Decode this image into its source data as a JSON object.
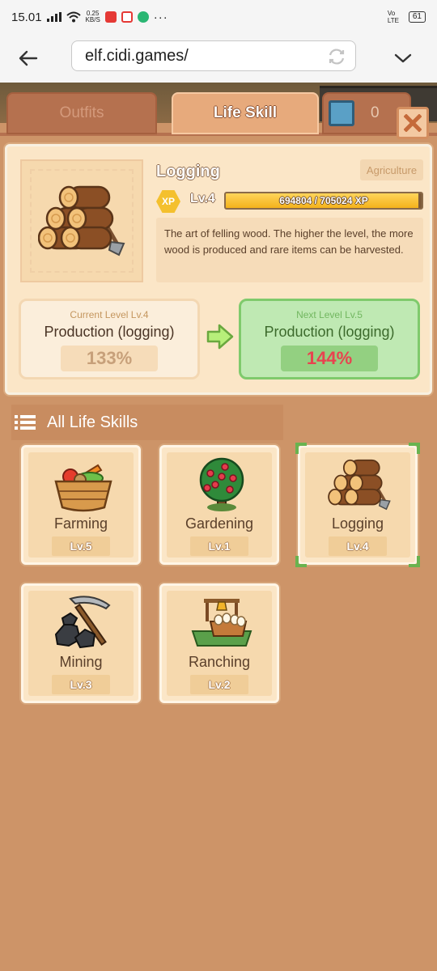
{
  "status_bar": {
    "time": "15.01",
    "net_speed": "0.25",
    "net_unit": "KB/S",
    "volte": "Vo LTE",
    "battery": "61"
  },
  "browser": {
    "url": "elf.cidi.games/"
  },
  "tabs": [
    {
      "label": "Outfits",
      "active": false
    },
    {
      "label": "Life Skill",
      "active": true
    },
    {
      "label": "0",
      "active": false
    }
  ],
  "detail": {
    "name": "Logging",
    "category": "Agriculture",
    "xp_badge": "XP",
    "level": "Lv.4",
    "xp_text": "694804 / 705024 XP",
    "xp_progress": 0.985,
    "description": "The art of felling wood. The higher the level, the more wood is produced and rare items can be harvested.",
    "current": {
      "sub": "Current Level Lv.4",
      "title": "Production (logging)",
      "value": "133%"
    },
    "next": {
      "sub": "Next Level Lv.5",
      "title": "Production (logging)",
      "value": "144%"
    }
  },
  "list": {
    "title": "All Life Skills",
    "skills": [
      {
        "name": "Farming",
        "level": "Lv.5",
        "selected": false,
        "icon": "basket-vegetables-icon"
      },
      {
        "name": "Gardening",
        "level": "Lv.1",
        "selected": false,
        "icon": "fruit-tree-icon"
      },
      {
        "name": "Logging",
        "level": "Lv.4",
        "selected": true,
        "icon": "logs-axe-icon"
      },
      {
        "name": "Mining",
        "level": "Lv.3",
        "selected": false,
        "icon": "coal-pickaxe-icon"
      },
      {
        "name": "Ranching",
        "level": "Lv.2",
        "selected": false,
        "icon": "egg-basket-icon"
      }
    ]
  },
  "colors": {
    "background": "#cd9468",
    "accent_green": "#7fca6c",
    "bonus_red": "#e8434f"
  }
}
